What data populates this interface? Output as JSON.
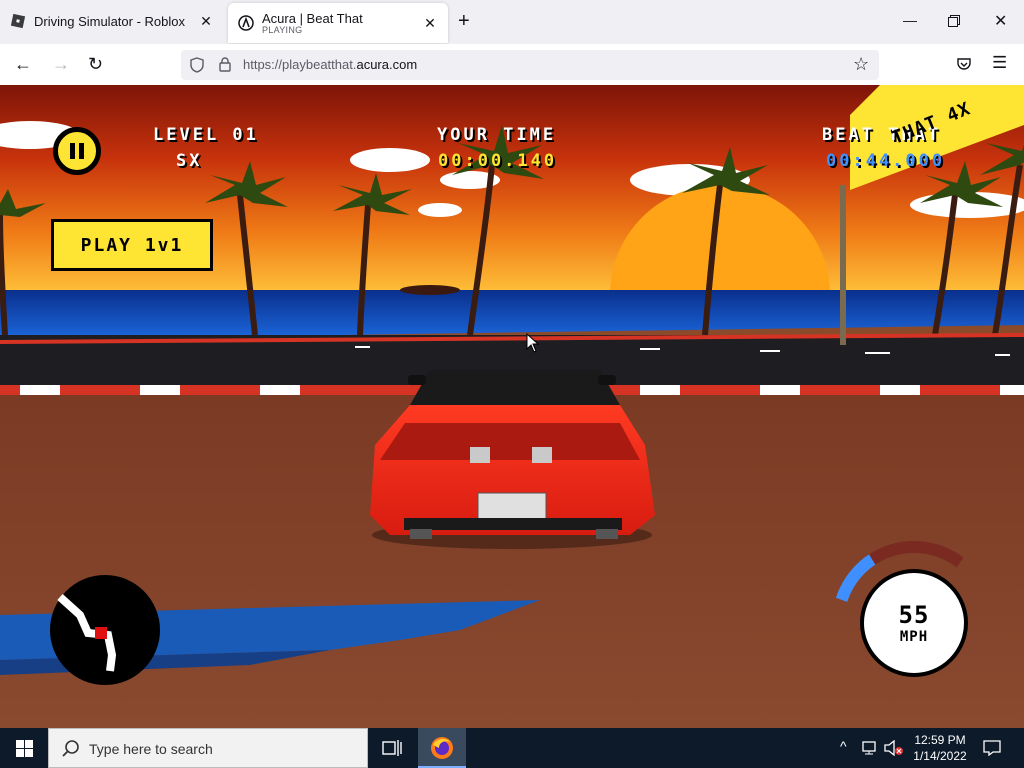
{
  "browser": {
    "tabs": [
      {
        "title": "Driving Simulator - Roblox",
        "subtitle": ""
      },
      {
        "title": "Acura | Beat That",
        "subtitle": "PLAYING"
      }
    ],
    "url_prefix": "https://playbeatthat.",
    "url_domain": "acura.com"
  },
  "game": {
    "level": "LEVEL 01",
    "car_code": "SX",
    "your_time_label": "YOUR TIME",
    "your_time_value": "00:00.140",
    "beat_that_label": "BEAT THAT",
    "beat_that_value": "00:44.000",
    "play_button": "PLAY 1v1",
    "banner_text": "THAT 4X",
    "speed_value": "55",
    "speed_unit": "MPH",
    "speed_gauge_fraction": 0.35
  },
  "taskbar": {
    "search_placeholder": "Type here to search",
    "time": "12:59 PM",
    "date": "1/14/2022"
  },
  "colors": {
    "hud_yellow": "#ffe533",
    "hud_blue": "#3f8fff",
    "car_red": "#f02a1a"
  }
}
